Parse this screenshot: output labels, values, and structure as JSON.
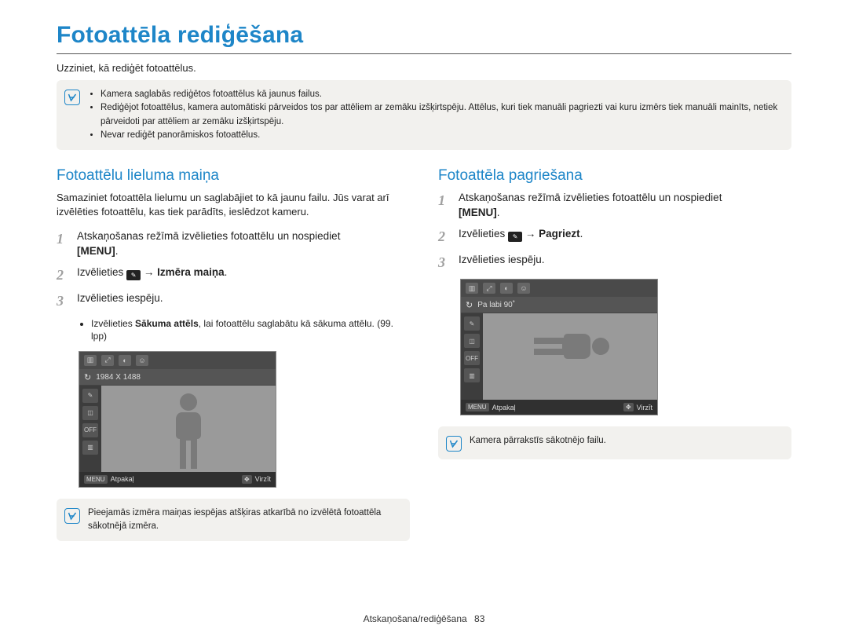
{
  "title": "Fotoattēla rediģēšana",
  "intro": "Uzziniet, kā rediģēt fotoattēlus.",
  "top_note": {
    "items": [
      "Kamera saglabās rediģētos fotoattēlus kā jaunus failus.",
      "Rediģējot fotoattēlus, kamera automātiski pārveidos tos par attēliem ar zemāku izšķirtspēju. Attēlus, kuri tiek manuāli pagriezti vai kuru izmērs tiek manuāli mainīts, netiek pārveidoti par attēliem ar zemāku izšķirtspēju.",
      "Nevar rediģēt panorāmiskos fotoattēlus."
    ]
  },
  "left": {
    "heading": "Fotoattēlu lieluma maiņa",
    "intro": "Samaziniet fotoattēla lielumu un saglabājiet to kā jaunu failu. Jūs varat arī izvēlēties fotoattēlu, kas tiek parādīts, ieslēdzot kameru.",
    "step1_a": "Atskaņošanas režīmā izvēlieties fotoattēlu un nospiediet",
    "menu": "[MENU]",
    "step2_a": "Izvēlieties",
    "step2_b": "→ Izmēra maiņa",
    "step3": "Izvēlieties iespēju.",
    "sub_a": "Izvēlieties ",
    "sub_b": "Sākuma attēls",
    "sub_c": ", lai fotoattēlu saglabātu kā sākuma attēlu. (99. lpp)",
    "screen_label": "1984 X 1488",
    "back": "Atpakaļ",
    "scroll": "Virzīt",
    "menu_tag": "MENU",
    "bottom_note": "Pieejamās izmēra maiņas iespējas atšķiras atkarībā no izvēlētā fotoattēla sākotnējā izmēra."
  },
  "right": {
    "heading": "Fotoattēla pagriešana",
    "step1_a": "Atskaņošanas režīmā izvēlieties fotoattēlu un nospiediet",
    "menu": "[MENU]",
    "step2_a": "Izvēlieties",
    "step2_b": "→ Pagriezt",
    "step3": "Izvēlieties iespēju.",
    "screen_label": "Pa labi 90˚",
    "back": "Atpakaļ",
    "scroll": "Virzīt",
    "menu_tag": "MENU",
    "bottom_note": "Kamera pārrakstīs sākotnējo failu."
  },
  "footer": {
    "section": "Atskaņošana/rediģēšana",
    "page": "83"
  }
}
